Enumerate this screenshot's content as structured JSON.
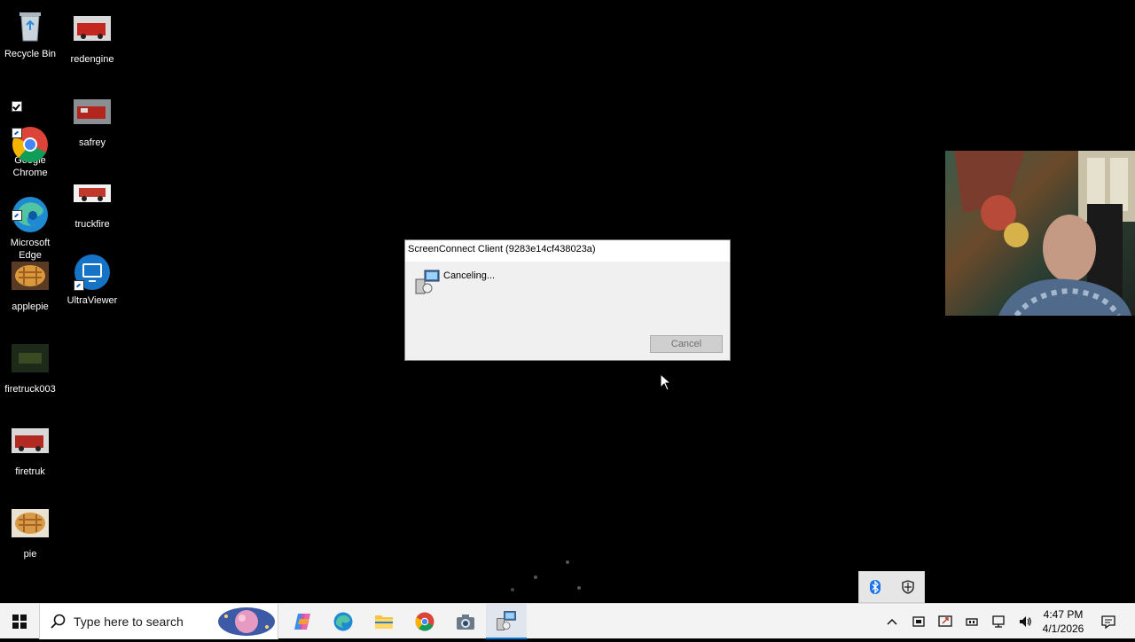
{
  "desktop": {
    "icons": [
      {
        "label": "Recycle Bin"
      },
      {
        "label": "redengine"
      },
      {
        "label": "Google\nChrome"
      },
      {
        "label": "safrey"
      },
      {
        "label": "Microsoft\nEdge"
      },
      {
        "label": "truckfire"
      },
      {
        "label": "applepie"
      },
      {
        "label": "UltraViewer"
      },
      {
        "label": "firetruck003"
      },
      {
        "label": "firetruk"
      },
      {
        "label": "pie"
      }
    ]
  },
  "dialog": {
    "title": "ScreenConnect Client (9283e14cf438023a)",
    "status": "Canceling...",
    "cancel_label": "Cancel"
  },
  "taskbar": {
    "search_placeholder": "Type here to search",
    "clock_time": "4:47 PM",
    "clock_date": "4/1/2026"
  },
  "colors": {
    "taskbar_bg": "#f3f3f3",
    "desktop_bg": "#000000",
    "accent_blue": "#0078d7"
  }
}
